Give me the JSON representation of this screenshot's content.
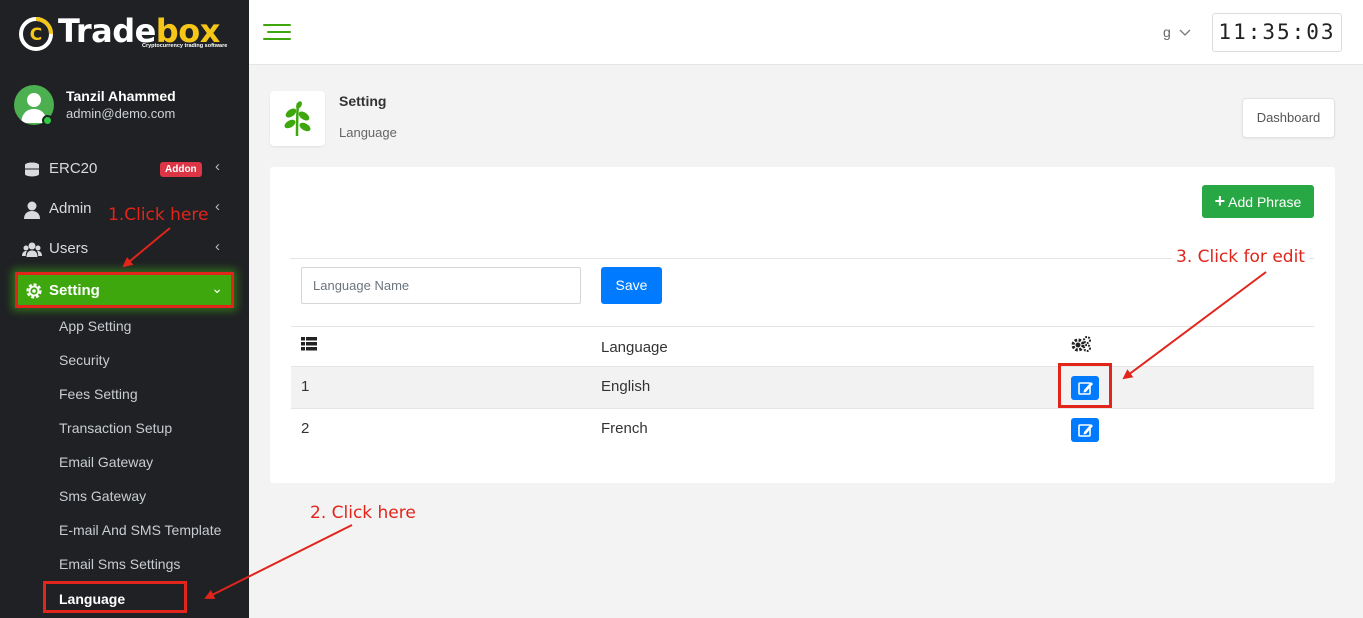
{
  "brand": {
    "name_part1": "Trade",
    "name_part2": "box",
    "tagline": "Cryptocurrency trading software"
  },
  "user": {
    "name": "Tanzil Ahammed",
    "email": "admin@demo.com"
  },
  "sidebar": {
    "items": [
      {
        "label": "ERC20",
        "badge": "Addon"
      },
      {
        "label": "Admin"
      },
      {
        "label": "Users"
      },
      {
        "label": "Setting"
      }
    ],
    "setting_submenu": [
      "App Setting",
      "Security",
      "Fees Setting",
      "Transaction Setup",
      "Email Gateway",
      "Sms Gateway",
      "E-mail And SMS Template",
      "Email Sms Settings",
      "Language"
    ]
  },
  "topbar": {
    "language_value": "g",
    "clock": "11:35:03"
  },
  "breadcrumb": {
    "title": "Setting",
    "subtitle": "Language",
    "dashboard_label": "Dashboard"
  },
  "card": {
    "add_phrase_label": "Add Phrase",
    "input_placeholder": "Language Name",
    "save_label": "Save",
    "table": {
      "columns": [
        "",
        "Language",
        ""
      ],
      "rows": [
        {
          "id": "1",
          "language": "English"
        },
        {
          "id": "2",
          "language": "French"
        }
      ]
    }
  },
  "annotations": {
    "step1": "1.Click here",
    "step2": "2. Click here",
    "step3": "3. Click for edit",
    "color": "#e1251b"
  },
  "colors": {
    "accent_green": "#3ea70d",
    "primary_blue": "#007bff",
    "success_green": "#28a745",
    "badge_red": "#dc3545",
    "sidebar_bg": "#1f2124"
  }
}
